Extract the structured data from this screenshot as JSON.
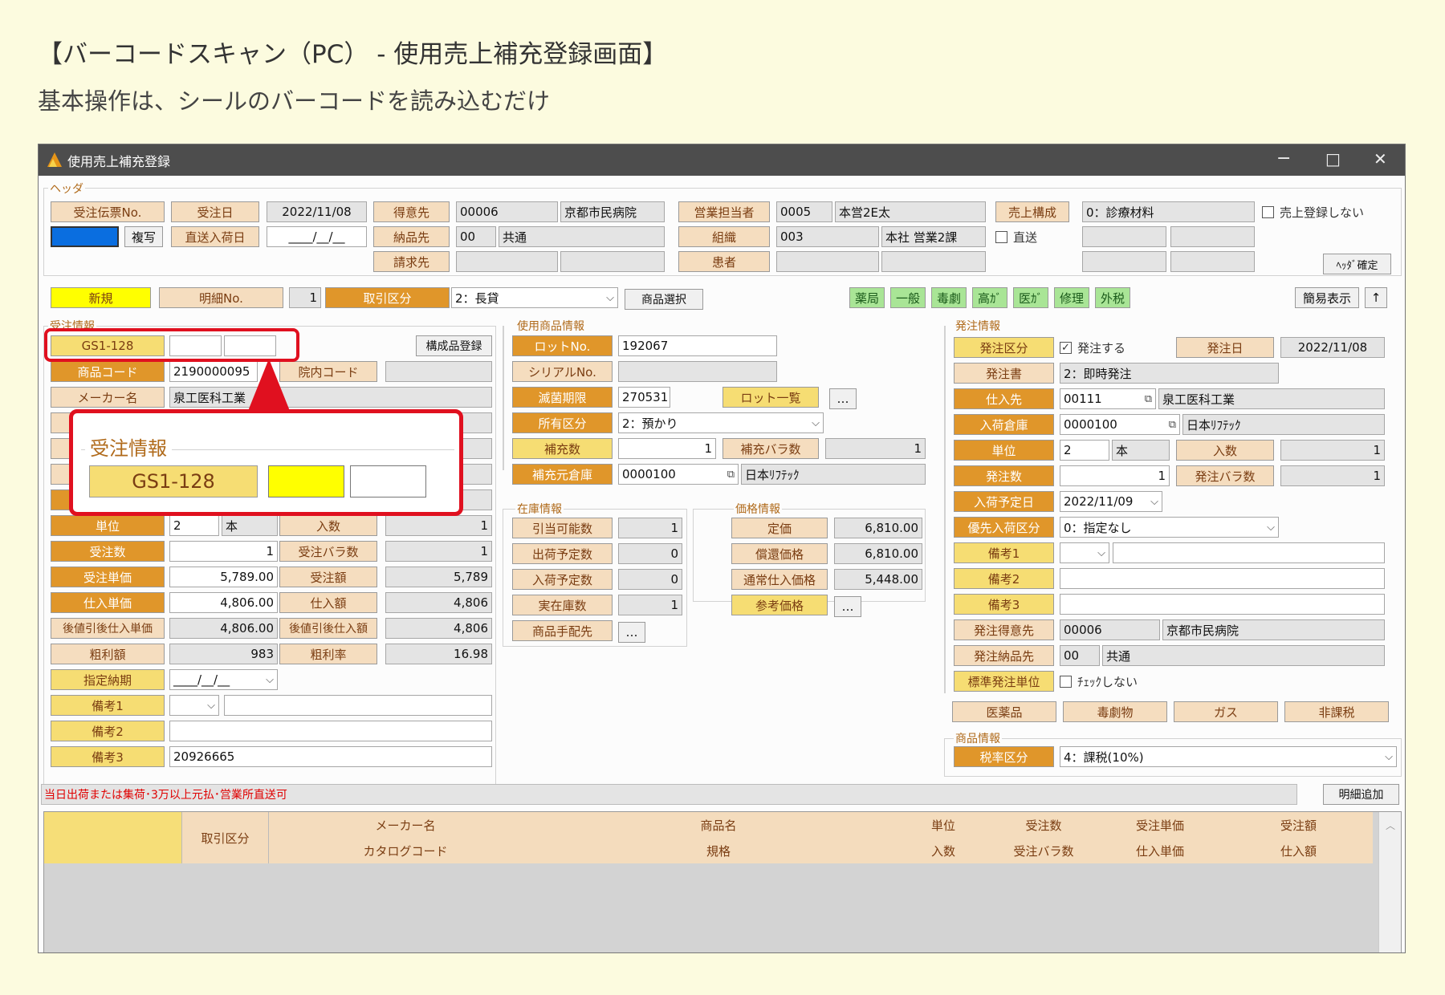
{
  "page": {
    "title": "【バーコードスキャン（PC） - 使用売上補充登録画面】",
    "subtitle": "基本操作は、シールのバーコードを読み込むだけ"
  },
  "window": {
    "title": "使用売上補充登録",
    "minimize": "−",
    "maximize": "□",
    "close": "✕"
  },
  "header": {
    "group": "ヘッダ",
    "order_no": "受注伝票No.",
    "copy": "複写",
    "order_date": "受注日",
    "order_date_val": "2022/11/08",
    "direct_date": "直送入荷日",
    "direct_date_val": "____/__/__",
    "customer": "得意先",
    "customer_code": "00006",
    "customer_name": "京都市民病院",
    "sales_rep": "営業担当者",
    "sales_rep_code": "0005",
    "sales_rep_name": "本営2E太",
    "sales_comp": "売上構成",
    "sales_comp_val": "0：診療材料",
    "no_sales": "売上登録しない",
    "delivery": "納品先",
    "delivery_code": "00",
    "delivery_name": "共通",
    "org": "組織",
    "org_code": "003",
    "org_name": "本社 営業2課",
    "direct": "直送",
    "billing": "請求先",
    "patient": "患者",
    "confirm": "ﾍｯﾀﾞ確定"
  },
  "toolbar": {
    "new": "新規",
    "line_no": "明細No.",
    "line_no_val": "1",
    "trade_type": "取引区分",
    "trade_type_val": "2：長貸",
    "product_select": "商品選択",
    "tags": [
      "薬局",
      "一般",
      "毒劇",
      "高ｶﾞ",
      "医ｶﾞ",
      "修理",
      "外税"
    ],
    "simple_view": "簡易表示",
    "up": "↑"
  },
  "order": {
    "group": "受注情報",
    "gs1": "GS1-128",
    "components": "構成品登録",
    "product_code": "商品コード",
    "product_code_val": "2190000095",
    "in_code": "院内コード",
    "maker": "メーカー名",
    "maker_val": "泉工医科工業",
    "unit": "単位",
    "unit_val": "2",
    "unit_name": "本",
    "qty_per": "入数",
    "qty_per_val": "1",
    "order_qty": "受注数",
    "order_qty_val": "1",
    "order_pcs": "受注バラ数",
    "order_pcs_val": "1",
    "unit_price": "受注単価",
    "unit_price_val": "5,789.00",
    "amount": "受注額",
    "amount_val": "5,789",
    "cost_price": "仕入単価",
    "cost_price_val": "4,806.00",
    "cost_amount": "仕入額",
    "cost_amount_val": "4,806",
    "post_disc_price": "後値引後仕入単価",
    "post_disc_price_val": "4,806.00",
    "post_disc_amount": "後値引後仕入額",
    "post_disc_amount_val": "4,806",
    "profit": "粗利額",
    "profit_val": "983",
    "profit_rate": "粗利率",
    "profit_rate_val": "16.98",
    "due": "指定納期",
    "due_val": "____/__/__",
    "note1": "備考1",
    "note2": "備考2",
    "note3": "備考3",
    "note3_val": "20926665"
  },
  "callout": {
    "label": "受注情報",
    "gs1": "GS1-128"
  },
  "used": {
    "group": "使用商品情報",
    "lot": "ロットNo.",
    "lot_val": "192067",
    "serial": "シリアルNo.",
    "expiry": "滅菌期限",
    "expiry_val": "270531",
    "lot_list": "ロット一覧",
    "more": "…",
    "ownership": "所有区分",
    "ownership_val": "2：預かり",
    "refill_qty": "補充数",
    "refill_qty_val": "1",
    "refill_pcs": "補充バラ数",
    "refill_pcs_val": "1",
    "src_wh": "補充元倉庫",
    "src_wh_code": "0000100",
    "src_wh_name": "日本ﾘﾌﾃｯｸ"
  },
  "stock": {
    "group": "在庫情報",
    "available": "引当可能数",
    "available_val": "1",
    "ship_plan": "出荷予定数",
    "ship_plan_val": "0",
    "arrive_plan": "入荷予定数",
    "arrive_plan_val": "0",
    "actual": "実在庫数",
    "actual_val": "1",
    "arrange": "商品手配先"
  },
  "price": {
    "group": "価格情報",
    "list": "定価",
    "list_val": "6,810.00",
    "reimb": "償還価格",
    "reimb_val": "6,810.00",
    "normal_cost": "通常仕入価格",
    "normal_cost_val": "5,448.00",
    "ref": "参考価格"
  },
  "po": {
    "group": "発注情報",
    "type": "発注区分",
    "type_val": "発注する",
    "date": "発注日",
    "date_val": "2022/11/08",
    "form": "発注書",
    "form_val": "2：即時発注",
    "supplier": "仕入先",
    "supplier_code": "00111",
    "supplier_name": "泉工医科工業",
    "wh": "入荷倉庫",
    "wh_code": "0000100",
    "wh_name": "日本ﾘﾌﾃｯｸ",
    "unit": "単位",
    "unit_val": "2",
    "unit_name": "本",
    "qty_per": "入数",
    "qty_per_val": "1",
    "qty": "発注数",
    "qty_val": "1",
    "pcs": "発注バラ数",
    "pcs_val": "1",
    "eta": "入荷予定日",
    "eta_val": "2022/11/09",
    "priority": "優先入荷区分",
    "priority_val": "0：指定なし",
    "note1": "備考1",
    "note2": "備考2",
    "note3": "備考3",
    "cust": "発注得意先",
    "cust_code": "00006",
    "cust_name": "京都市民病院",
    "dest": "発注納品先",
    "dest_code": "00",
    "dest_name": "共通",
    "std_unit": "標準発注単位",
    "std_unit_chk": "ﾁｪｯｸしない",
    "flags": [
      "医薬品",
      "毒劇物",
      "ガス",
      "非課税"
    ]
  },
  "product": {
    "group": "商品情報",
    "tax": "税率区分",
    "tax_val": "4：課税(10%)"
  },
  "message": "当日出荷または集荷･3万以上元払･営業所直送可",
  "add_line": "明細追加",
  "grid": {
    "trade": "取引区分",
    "row1": [
      "メーカー名",
      "商品名",
      "単位",
      "受注数",
      "受注単価",
      "受注額"
    ],
    "row2": [
      "カタログコード",
      "規格",
      "入数",
      "受注バラ数",
      "仕入単価",
      "仕入額"
    ]
  }
}
